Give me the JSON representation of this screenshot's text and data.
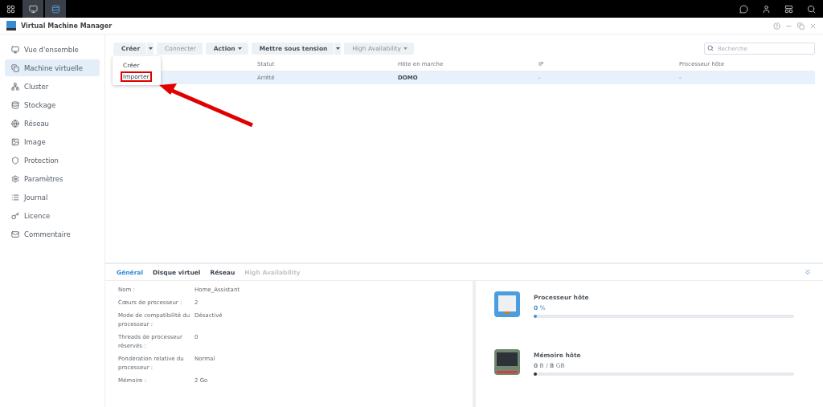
{
  "window": {
    "title": "Virtual Machine Manager"
  },
  "sidebar": {
    "items": [
      {
        "label": "Vue d'ensemble",
        "selected": false
      },
      {
        "label": "Machine virtuelle",
        "selected": true
      },
      {
        "label": "Cluster",
        "selected": false
      },
      {
        "label": "Stockage",
        "selected": false
      },
      {
        "label": "Réseau",
        "selected": false
      },
      {
        "label": "Image",
        "selected": false
      },
      {
        "label": "Protection",
        "selected": false
      },
      {
        "label": "Paramètres",
        "selected": false
      },
      {
        "label": "Journal",
        "selected": false
      },
      {
        "label": "Licence",
        "selected": false
      },
      {
        "label": "Commentaire",
        "selected": false
      }
    ]
  },
  "toolbar": {
    "buttons": [
      {
        "label": "Créer",
        "disabled": false,
        "kind": "split"
      },
      {
        "label": "Connecter",
        "disabled": true,
        "kind": "plain"
      },
      {
        "label": "Action",
        "disabled": false,
        "kind": "menu"
      },
      {
        "label": "Mettre sous tension",
        "disabled": false,
        "kind": "split"
      },
      {
        "label": "High Availability",
        "disabled": true,
        "kind": "menu"
      }
    ],
    "search": {
      "placeholder": "Recherche"
    }
  },
  "dropdown": {
    "items": [
      {
        "label": "Créer",
        "highlighted": false
      },
      {
        "label": "Importer",
        "highlighted": true
      }
    ]
  },
  "table": {
    "columns": [
      "Statut",
      "Hôte en marche",
      "IP",
      "Processeur hôte"
    ],
    "rows": [
      {
        "selected": true,
        "cells": [
          "Arrêté",
          "DOMO",
          "-",
          "-"
        ]
      }
    ]
  },
  "details": {
    "tabs": [
      {
        "label": "Général",
        "selected": true,
        "disabled": false
      },
      {
        "label": "Disque virtuel",
        "selected": false,
        "disabled": false
      },
      {
        "label": "Réseau",
        "selected": false,
        "disabled": false
      },
      {
        "label": "High Availability",
        "selected": false,
        "disabled": true
      }
    ],
    "fields": [
      {
        "label": "Nom :",
        "value": "Home_Assistant"
      },
      {
        "label": "Cœurs de processeur :",
        "value": "2"
      },
      {
        "label": "Mode de compatibilité du processeur :",
        "value": "Désactivé"
      },
      {
        "label": "Threads de processeur réservés :",
        "value": "0"
      },
      {
        "label": "Pondération relative du processeur :",
        "value": "Normal"
      },
      {
        "label": "Mémoire :",
        "value": "2 Go"
      }
    ],
    "meters": [
      {
        "kind": "cpu",
        "title": "Processeur hôte",
        "reading": "**0** %",
        "level": 0.005
      },
      {
        "kind": "memory",
        "title": "Mémoire hôte",
        "reading": "**0** B / **8** GB",
        "level": 0.004
      }
    ]
  }
}
